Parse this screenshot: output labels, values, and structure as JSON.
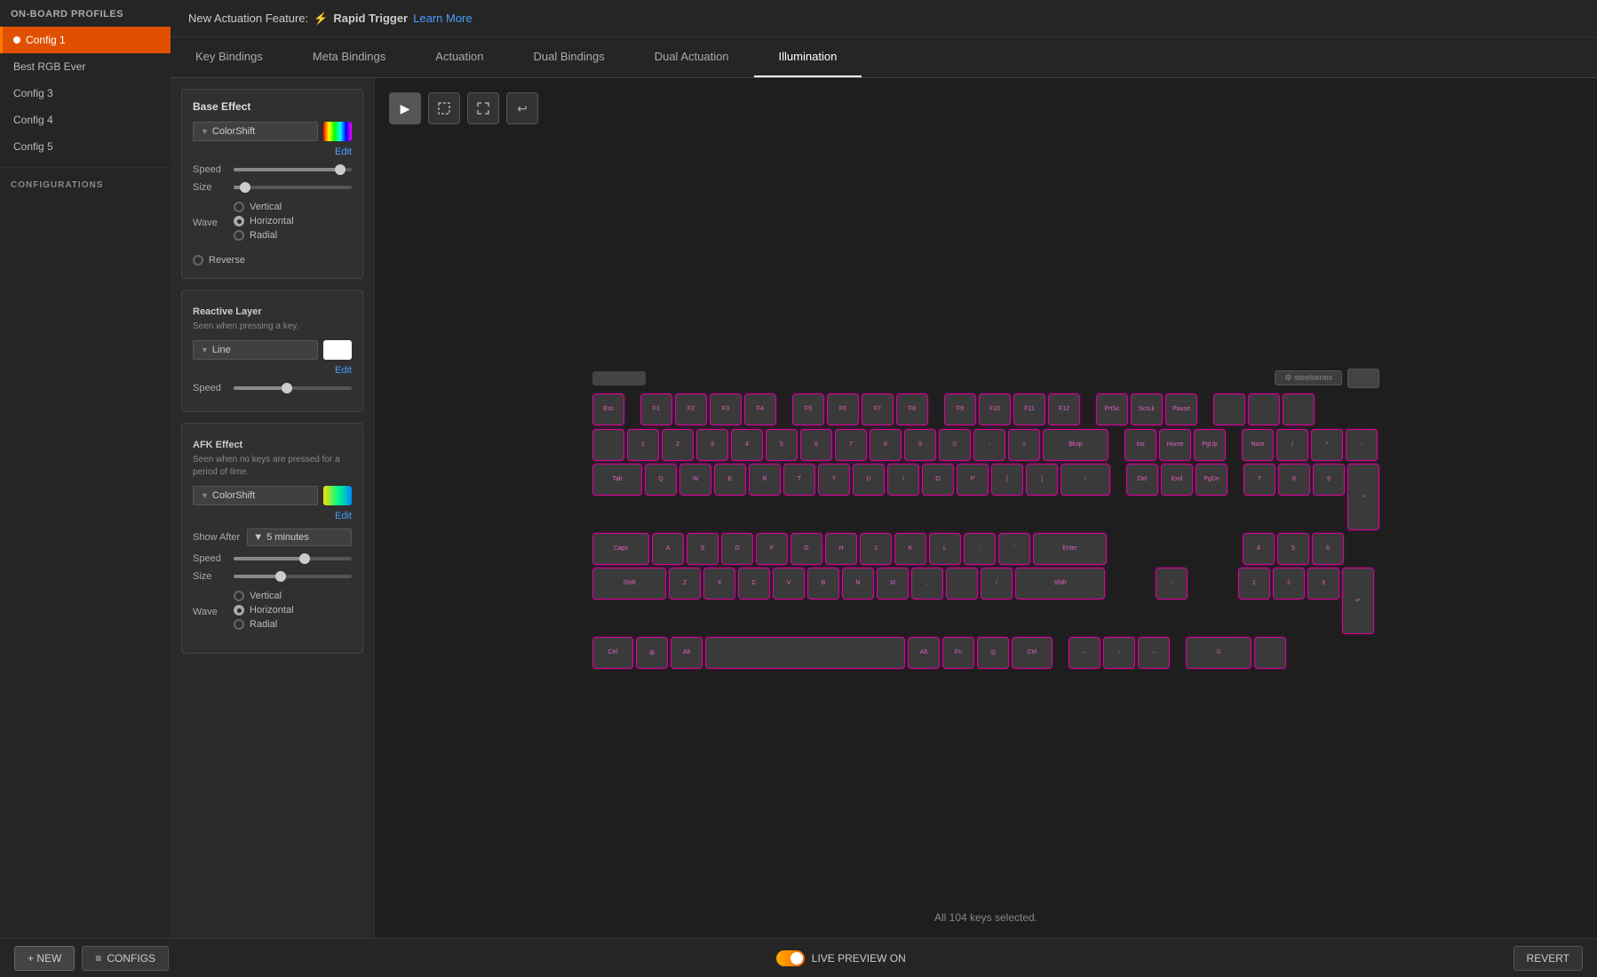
{
  "sidebar": {
    "title": "ON-BOARD PROFILES",
    "profiles": [
      {
        "id": "config1",
        "label": "Config 1",
        "active": true
      },
      {
        "id": "config2",
        "label": "Best RGB Ever",
        "active": false
      },
      {
        "id": "config3",
        "label": "Config 3",
        "active": false
      },
      {
        "id": "config4",
        "label": "Config 4",
        "active": false
      },
      {
        "id": "config5",
        "label": "Config 5",
        "active": false
      }
    ],
    "section_label": "CONFIGURATIONS"
  },
  "banner": {
    "text": "New Actuation Feature: ",
    "bolt": "⚡",
    "feature": "Rapid Trigger",
    "learn_more": "Learn More"
  },
  "tabs": [
    {
      "id": "key-bindings",
      "label": "Key Bindings",
      "active": false
    },
    {
      "id": "meta-bindings",
      "label": "Meta Bindings",
      "active": false
    },
    {
      "id": "actuation",
      "label": "Actuation",
      "active": false
    },
    {
      "id": "dual-bindings",
      "label": "Dual Bindings",
      "active": false
    },
    {
      "id": "dual-actuation",
      "label": "Dual Actuation",
      "active": false
    },
    {
      "id": "illumination",
      "label": "Illumination",
      "active": true
    }
  ],
  "left_panel": {
    "base_effect": {
      "title": "Base Effect",
      "effect_name": "ColorShift",
      "edit_label": "Edit"
    },
    "speed_label": "Speed",
    "size_label": "Size",
    "wave_label": "Wave",
    "wave_options": [
      "Vertical",
      "Horizontal",
      "Radial"
    ],
    "wave_selected": "Horizontal",
    "reverse_label": "Reverse",
    "reactive_layer": {
      "title": "Reactive Layer",
      "desc": "Seen when pressing a key.",
      "effect_name": "Line",
      "edit_label": "Edit",
      "speed_label": "Speed"
    },
    "afk_effect": {
      "title": "AFK Effect",
      "desc": "Seen when no keys are pressed for a period of time.",
      "effect_name": "ColorShift",
      "edit_label": "Edit",
      "show_after_label": "Show After",
      "show_after_value": "5 minutes",
      "speed_label": "Speed",
      "size_label": "Size",
      "wave_label": "Wave",
      "wave_options": [
        "Vertical",
        "Horizontal",
        "Radial"
      ],
      "wave_selected": "Horizontal"
    }
  },
  "keyboard": {
    "status_text": "All 104 keys selected.",
    "logo": "steelseries",
    "toolbar": {
      "select_icon": "▶",
      "rect_select_icon": "⬜",
      "fullscreen_icon": "⛶",
      "undo_icon": "↩"
    }
  },
  "bottom_bar": {
    "new_label": "+ NEW",
    "configs_label": "CONFIGS",
    "live_preview_label": "LIVE PREVIEW ON",
    "revert_label": "REVERT"
  }
}
